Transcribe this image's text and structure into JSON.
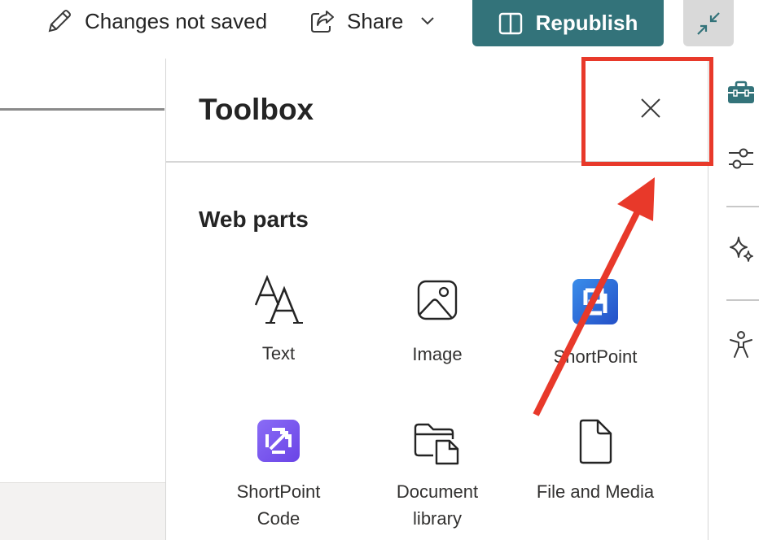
{
  "toolbar": {
    "save_status": "Changes not saved",
    "share_label": "Share",
    "republish_label": "Republish"
  },
  "toolbox": {
    "title": "Toolbox",
    "section_title": "Web parts",
    "web_parts": [
      {
        "label": "Text",
        "icon": "text-icon"
      },
      {
        "label": "Image",
        "icon": "image-icon"
      },
      {
        "label": "ShortPoint",
        "icon": "shortpoint-icon"
      },
      {
        "label": "ShortPoint Code",
        "line1": "ShortPoint",
        "line2": "Code",
        "icon": "shortpoint-code-icon"
      },
      {
        "label": "Document library",
        "line1": "Document",
        "line2": "library",
        "icon": "document-library-icon"
      },
      {
        "label": "File and Media",
        "icon": "file-icon"
      }
    ]
  },
  "rail": {
    "items": [
      "toolbox-icon",
      "settings-sliders-icon",
      "sparkle-icon",
      "accessibility-icon"
    ]
  },
  "colors": {
    "accent": "#33737a",
    "annotation": "#e8392a",
    "shortpoint_blue": "#2f6fe0",
    "shortpoint_purple": "#7b5cf0"
  }
}
